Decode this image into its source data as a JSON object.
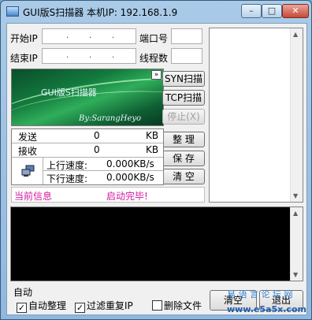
{
  "window": {
    "title": "GUI版S扫描器   本机IP: 192.168.1.9",
    "min_glyph": "–",
    "max_glyph": "□",
    "close_glyph": "✕"
  },
  "form": {
    "start_ip_label": "开始IP",
    "end_ip_label": "结束IP",
    "port_label": "端口号",
    "threads_label": "线程数",
    "ip_dot": "."
  },
  "banner": {
    "title": "GUI版S扫描器",
    "credit": "By:SarangHeyo",
    "expand_glyph": "»"
  },
  "buttons": {
    "syn_scan": "SYN扫描",
    "tcp_scan": "TCP扫描",
    "stop": "停止(X)",
    "organize": "整 理",
    "save": "保 存",
    "clear": "清 空",
    "clear_log": "清空",
    "exit": "退出"
  },
  "stats": {
    "send_label": "发送",
    "send_value": "0",
    "send_unit": "KB",
    "recv_label": "接收",
    "recv_value": "0",
    "recv_unit": "KB",
    "up_label": "上行速度:",
    "up_value": "0.000KB/s",
    "down_label": "下行速度:",
    "down_value": "0.000KB/s"
  },
  "status": {
    "label": "当前信息",
    "value": "启动完毕!"
  },
  "options": {
    "group_label": "自动",
    "auto_organize": "自动整理",
    "auto_organize_checked": true,
    "filter_dup_ip": "过滤重复IP",
    "filter_dup_ip_checked": true,
    "delete_file": "删除文件",
    "delete_file_checked": false
  },
  "watermark": {
    "line1": "易 语 言 论 坛 网",
    "line2": "www.e5a5x.com"
  },
  "colors": {
    "status_text": "#d21aa0",
    "log_bg": "#000000",
    "banner_bg": "#137a3d"
  }
}
